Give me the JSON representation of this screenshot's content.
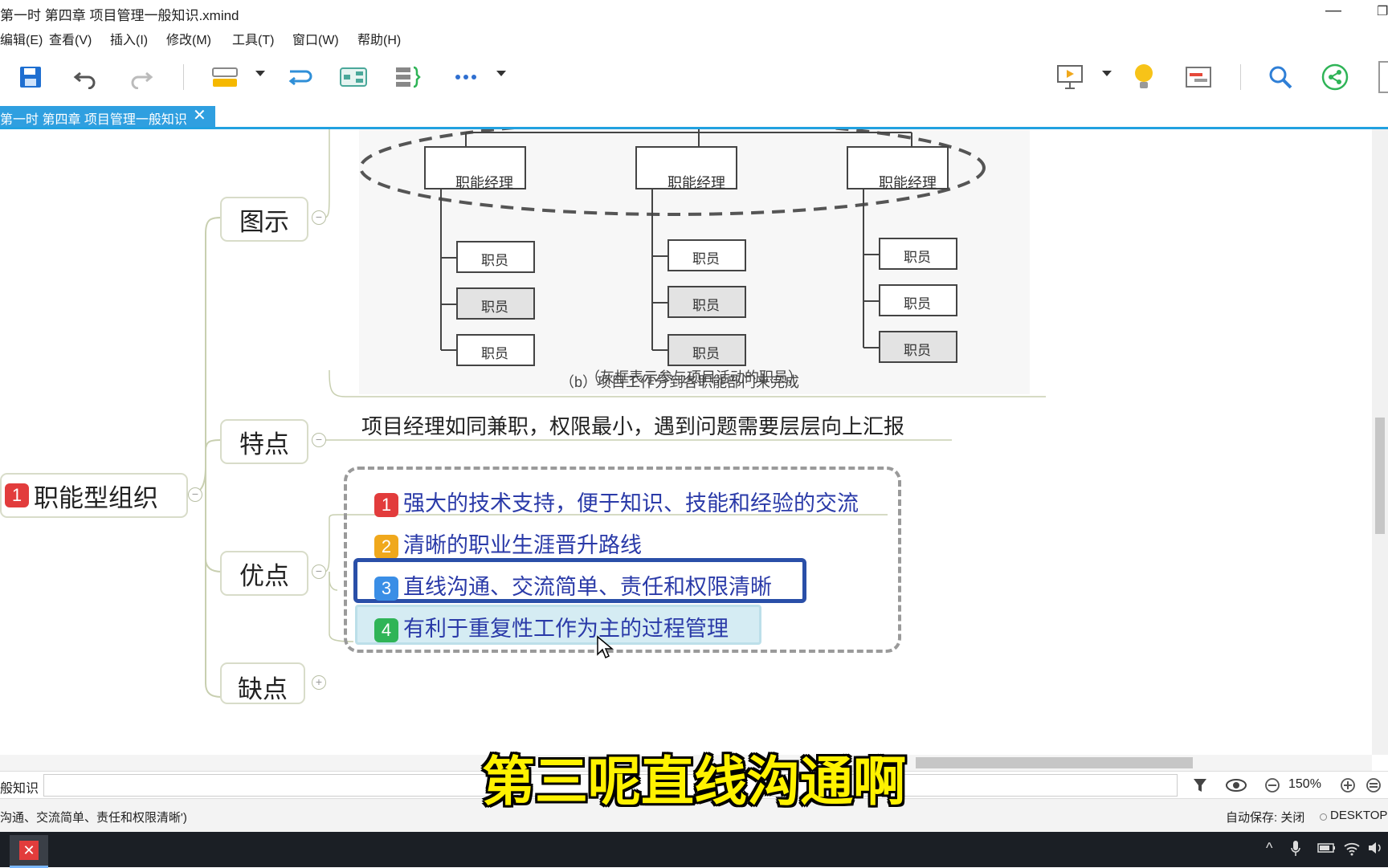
{
  "window": {
    "title": "第一时 第四章 项目管理一般知识.xmind",
    "minimize": "—",
    "restore": "❐"
  },
  "menu": [
    "编辑(E)",
    "查看(V)",
    "插入(I)",
    "修改(M)",
    "工具(T)",
    "窗口(W)",
    "帮助(H)"
  ],
  "toolbar": {
    "icons": [
      "save-icon",
      "undo-icon",
      "redo-icon",
      "topic-style-icon",
      "relationship-icon",
      "structure-icon",
      "summary-icon",
      "more-icon",
      "presentation-icon",
      "idea-icon",
      "gantt-icon",
      "search-icon",
      "share-icon"
    ]
  },
  "tab": {
    "label": "第一时 第四章 项目管理一般知识",
    "close": "✕"
  },
  "mindmap": {
    "root": {
      "badge": "1",
      "label": "职能型组织"
    },
    "branches": {
      "diagram": "图示",
      "features": "特点",
      "advantages": "优点",
      "disadvantages": "缺点"
    },
    "features_text": "项目经理如同兼职，权限最小，遇到问题需要层层向上汇报",
    "advantages": [
      {
        "badge": "1",
        "text": "强大的技术支持，便于知识、技能和经验的交流",
        "color": "#e23c3c"
      },
      {
        "badge": "2",
        "text": "清晰的职业生涯晋升路线",
        "color": "#f0a81c"
      },
      {
        "badge": "3",
        "text": "直线沟通、交流简单、责任和权限清晰",
        "color": "#3a8ee6"
      },
      {
        "badge": "4",
        "text": "有利于重复性工作为主的过程管理",
        "color": "#2fb457"
      }
    ],
    "org_chart": {
      "managers": [
        "职能经理",
        "职能经理",
        "职能经理"
      ],
      "staff": [
        [
          "职员",
          "职员",
          "职员"
        ],
        [
          "职员",
          "职员",
          "职员"
        ],
        [
          "职员",
          "职员",
          "职员"
        ]
      ],
      "note": "（灰框表示参与项目活动的职员）",
      "caption": "（b）项目工作分到各职能部门来完成"
    }
  },
  "outline": {
    "label": "般知识",
    "zoom": "150%"
  },
  "status": {
    "left": "沟通、交流简单、责任和权限清晰')",
    "autosave": "自动保存: 关闭",
    "machine": "DESKTOP"
  },
  "subtitle": "第三呢直线沟通啊"
}
